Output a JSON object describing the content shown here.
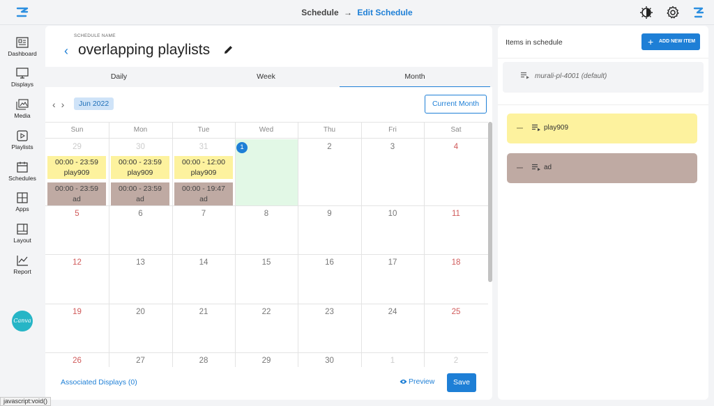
{
  "breadcrumb": {
    "parent": "Schedule",
    "arrow": "→",
    "current": "Edit Schedule"
  },
  "sidebar": {
    "items": [
      {
        "label": "Dashboard",
        "icon": "dashboard-icon"
      },
      {
        "label": "Displays",
        "icon": "monitor-icon"
      },
      {
        "label": "Media",
        "icon": "media-icon"
      },
      {
        "label": "Playlists",
        "icon": "playlist-icon"
      },
      {
        "label": "Schedules",
        "icon": "calendar-icon"
      },
      {
        "label": "Apps",
        "icon": "apps-icon"
      },
      {
        "label": "Layout",
        "icon": "layout-icon"
      },
      {
        "label": "Report",
        "icon": "report-icon"
      }
    ],
    "canva_label": "Canva"
  },
  "schedule": {
    "name_label": "SCHEDULE NAME",
    "name": "overlapping playlists",
    "back": "‹"
  },
  "tabs": [
    {
      "label": "Daily",
      "active": false
    },
    {
      "label": "Week",
      "active": false
    },
    {
      "label": "Month",
      "active": true
    }
  ],
  "calendar": {
    "prev": "‹",
    "next": "›",
    "month": "Jun 2022",
    "current_month_label": "Current Month",
    "days_of_week": [
      "Sun",
      "Mon",
      "Tue",
      "Wed",
      "Thu",
      "Fri",
      "Sat"
    ],
    "weeks": [
      [
        "29",
        "30",
        "31",
        "1",
        "2",
        "3",
        "4"
      ],
      [
        "5",
        "6",
        "7",
        "8",
        "9",
        "10",
        "11"
      ],
      [
        "12",
        "13",
        "14",
        "15",
        "16",
        "17",
        "18"
      ],
      [
        "19",
        "20",
        "21",
        "22",
        "23",
        "24",
        "25"
      ],
      [
        "26",
        "27",
        "28",
        "29",
        "30",
        "1",
        "2"
      ]
    ],
    "today": "1",
    "events": [
      {
        "time": "00:00 - 23:59",
        "name": "play909",
        "color": "#fdf29e"
      },
      {
        "time": "00:00 - 23:59",
        "name": "ad",
        "color": "#bfaaa3"
      },
      {
        "time": "00:00 - 23:59",
        "name": "play909",
        "color": "#fdf29e"
      },
      {
        "time": "00:00 - 23:59",
        "name": "ad",
        "color": "#bfaaa3"
      },
      {
        "time": "00:00 - 12:00",
        "name": "play909",
        "color": "#fdf29e"
      },
      {
        "time": "00:00 - 19:47",
        "name": "ad",
        "color": "#bfaaa3"
      }
    ]
  },
  "footer": {
    "associated": "Associated Displays (0)",
    "preview": "Preview",
    "save": "Save"
  },
  "right_panel": {
    "title": "Items in schedule",
    "add_button": "ADD NEW ITEM",
    "default_item": "murali-pl-4001 (default)",
    "items": [
      {
        "name": "play909",
        "color": "#fdf29e"
      },
      {
        "name": "ad",
        "color": "#bfaaa3"
      }
    ]
  },
  "status_tip": "javascript:void()",
  "colors": {
    "accent": "#1e7fd6",
    "today": "#e2f8e6",
    "weekend": "#d05a5a"
  }
}
